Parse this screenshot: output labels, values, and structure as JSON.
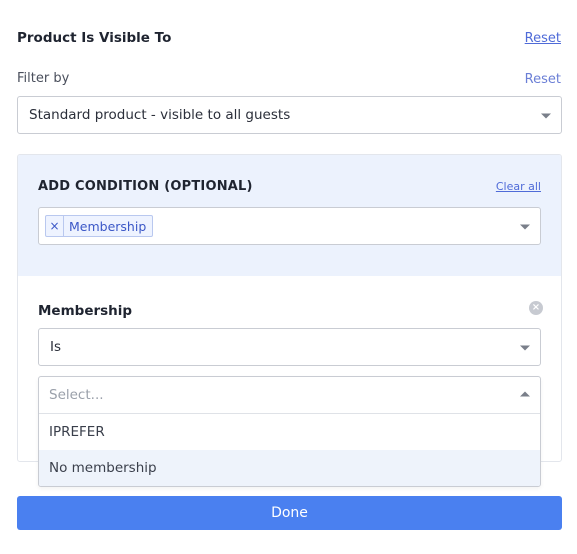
{
  "panel": {
    "title": "Product Is Visible To",
    "reset_label": "Reset"
  },
  "filter": {
    "label": "Filter by",
    "reset_label": "Reset",
    "selected_value": "Standard product - visible to all guests"
  },
  "condition": {
    "title": "ADD CONDITION (OPTIONAL)",
    "clear_all_label": "Clear all",
    "tags": [
      {
        "label": "Membership",
        "remove_glyph": "×"
      }
    ]
  },
  "rule": {
    "title": "Membership",
    "remove_glyph": "×",
    "operator_value": "Is",
    "value_placeholder": "Select...",
    "options": [
      {
        "label": "IPREFER"
      },
      {
        "label": "No membership"
      }
    ]
  },
  "footer": {
    "done_label": "Done",
    "accent_color": "#4a80f0"
  },
  "icons": {
    "dropdown": "chevron-down-icon",
    "dropdown_open": "chevron-up-icon",
    "tag_remove": "close-icon",
    "rule_remove": "close-circle-icon"
  }
}
